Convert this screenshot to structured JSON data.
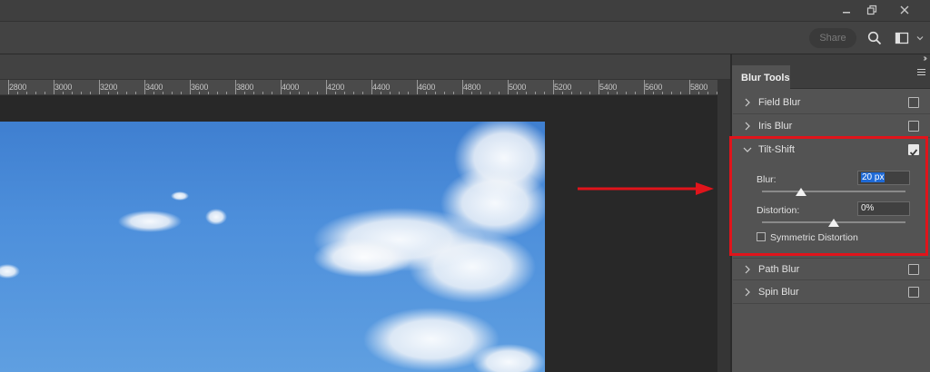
{
  "window": {
    "controls": [
      "minimize-icon",
      "restore-icon",
      "close-icon"
    ]
  },
  "options_bar": {
    "share_label": "Share",
    "icons": [
      "search-icon",
      "workspace-icon",
      "chevron-down-icon"
    ]
  },
  "ruler": {
    "ticks": [
      "2800",
      "3000",
      "3200",
      "3400",
      "3600",
      "3800",
      "4000",
      "4200",
      "4400",
      "4600",
      "4800",
      "5000",
      "5200",
      "5400",
      "5600",
      "5800"
    ]
  },
  "blur_panel": {
    "tab_label": "Blur Tools",
    "sections": [
      {
        "label": "Field Blur",
        "expanded": false,
        "checked": false
      },
      {
        "label": "Iris Blur",
        "expanded": false,
        "checked": false
      },
      {
        "label": "Tilt-Shift",
        "expanded": true,
        "checked": true
      },
      {
        "label": "Path Blur",
        "expanded": false,
        "checked": false
      },
      {
        "label": "Spin Blur",
        "expanded": false,
        "checked": false
      }
    ],
    "tilt_shift": {
      "blur_label": "Blur:",
      "blur_value": "20 px",
      "blur_slider_fraction": 0.27,
      "distortion_label": "Distortion:",
      "distortion_value": "0%",
      "distortion_slider_fraction": 0.5,
      "symmetric_label": "Symmetric Distortion",
      "symmetric_checked": false
    }
  },
  "colors": {
    "highlight": "#e0141b",
    "panel_bg": "#535353",
    "selection": "#1f6ad6"
  }
}
